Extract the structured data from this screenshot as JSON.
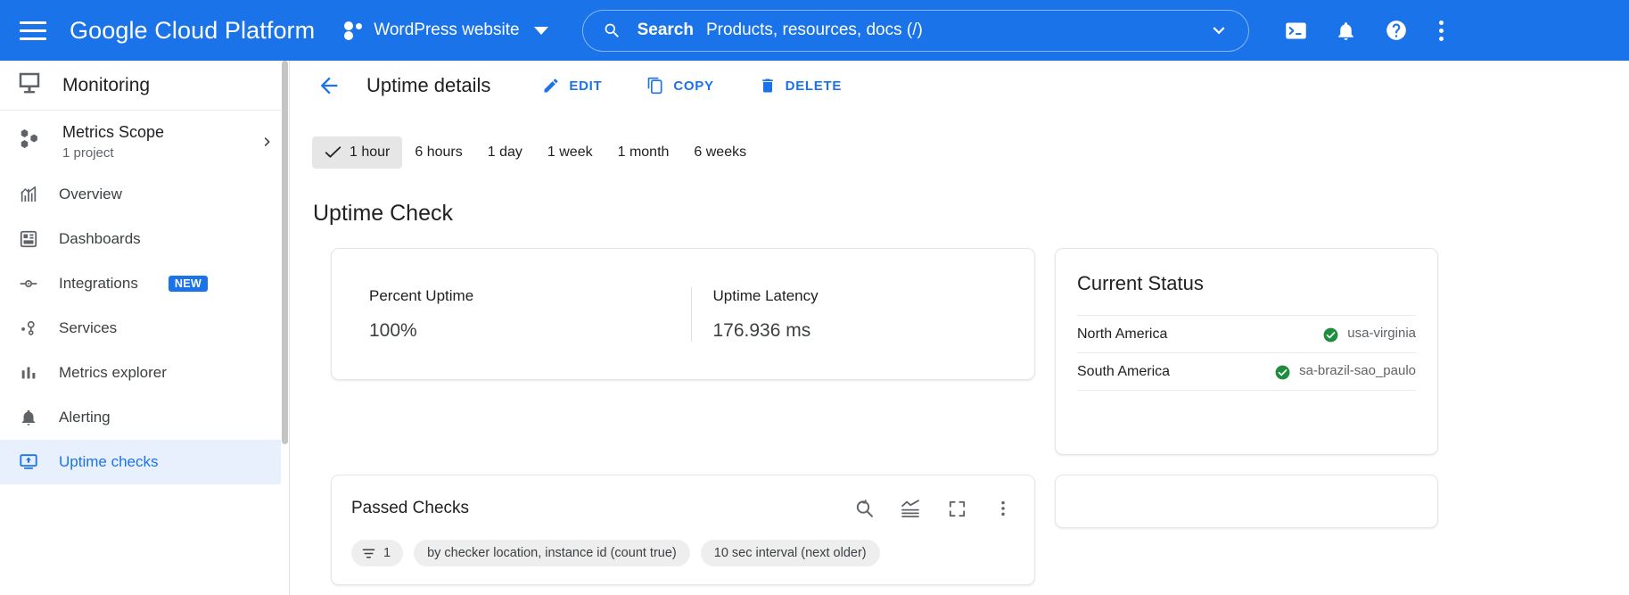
{
  "topbar": {
    "menu_icon": "hamburger-icon",
    "brand": "Google Cloud Platform",
    "project_name": "WordPress website",
    "project_dropdown_icon": "caret-down-icon",
    "search": {
      "icon": "search-icon",
      "label": "Search",
      "placeholder": "Products, resources, docs (/)",
      "value": "",
      "dropdown_icon": "chevron-down-icon"
    },
    "icons": [
      {
        "name": "cloud-shell-icon",
        "title": "Activate Cloud Shell"
      },
      {
        "name": "notifications-bell-icon",
        "title": "Notifications"
      },
      {
        "name": "help-question-icon",
        "title": "Help"
      },
      {
        "name": "more-vert-kebab-icon",
        "title": "More options"
      }
    ],
    "accent_color": "#1a73e8"
  },
  "sidebar": {
    "product_icon": "monitoring-icon",
    "product_title": "Monitoring",
    "scope": {
      "icon": "metrics-scope-icon",
      "title": "Metrics Scope",
      "subtitle": "1 project",
      "chevron": "chevron-right-icon"
    },
    "items": [
      {
        "label": "Overview",
        "icon": "overview-chart-icon",
        "active": false,
        "badge": ""
      },
      {
        "label": "Dashboards",
        "icon": "dashboards-grid-icon",
        "active": false,
        "badge": ""
      },
      {
        "label": "Integrations",
        "icon": "integrations-node-icon",
        "active": false,
        "badge": "NEW"
      },
      {
        "label": "Services",
        "icon": "services-nodes-icon",
        "active": false,
        "badge": ""
      },
      {
        "label": "Metrics explorer",
        "icon": "bar-chart-icon",
        "active": false,
        "badge": ""
      },
      {
        "label": "Alerting",
        "icon": "bell-icon",
        "active": false,
        "badge": ""
      },
      {
        "label": "Uptime checks",
        "icon": "uptime-monitor-icon",
        "active": true,
        "badge": ""
      }
    ],
    "active_color": "#1a73e8",
    "active_bg": "#e8f0fe"
  },
  "main": {
    "back_icon": "back-arrow-icon",
    "title": "Uptime details",
    "actions": [
      {
        "label": "EDIT",
        "icon": "pencil-edit-icon"
      },
      {
        "label": "COPY",
        "icon": "copy-duplicate-icon"
      },
      {
        "label": "DELETE",
        "icon": "trash-delete-icon"
      }
    ],
    "time_ranges": [
      {
        "label": "1 hour",
        "selected": true
      },
      {
        "label": "6 hours",
        "selected": false
      },
      {
        "label": "1 day",
        "selected": false
      },
      {
        "label": "1 week",
        "selected": false
      },
      {
        "label": "1 month",
        "selected": false
      },
      {
        "label": "6 weeks",
        "selected": false
      }
    ],
    "selected_check_icon": "check-mark-icon",
    "section_title": "Uptime Check",
    "metrics": [
      {
        "label": "Percent Uptime",
        "value": "100%"
      },
      {
        "label": "Uptime Latency",
        "value": "176.936 ms"
      }
    ],
    "current_status": {
      "title": "Current Status",
      "rows": [
        {
          "region": "North America",
          "status_icon": "check-circle-icon",
          "location": "usa-virginia",
          "status_color": "#1e8e3e"
        },
        {
          "region": "South America",
          "status_icon": "check-circle-icon",
          "location": "sa-brazil-sao_paulo",
          "status_color": "#1e8e3e"
        }
      ]
    },
    "passed_checks": {
      "title": "Passed Checks",
      "tools": [
        {
          "name": "reset-zoom-icon"
        },
        {
          "name": "chart-type-icon"
        },
        {
          "name": "fullscreen-expand-icon"
        },
        {
          "name": "more-vert-kebab-icon"
        }
      ],
      "chips": [
        {
          "label": "1",
          "icon": "filter-lines-icon"
        },
        {
          "label": "by checker location, instance id (count true)",
          "icon": ""
        },
        {
          "label": "10 sec interval (next older)",
          "icon": ""
        }
      ]
    }
  }
}
